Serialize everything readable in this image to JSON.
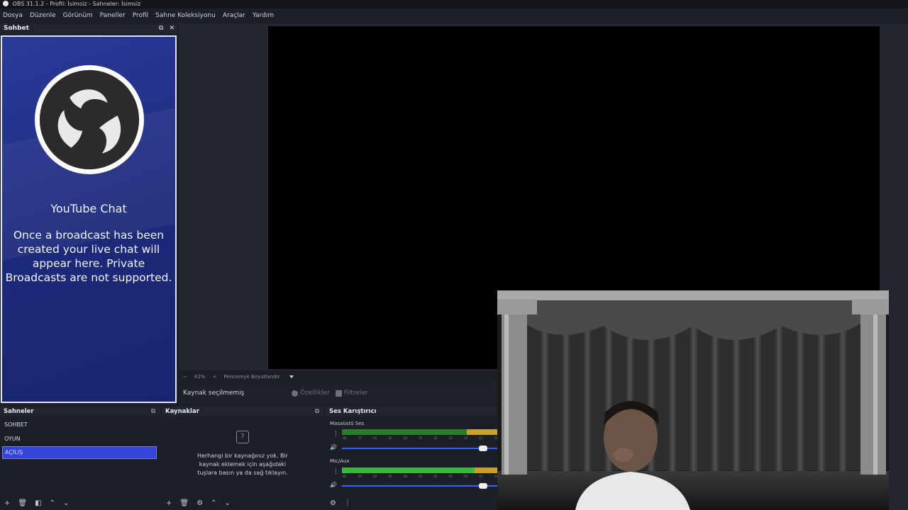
{
  "window": {
    "title": "OBS 31.1.2 - Profil: İsimsiz - Sahneler: İsimsiz"
  },
  "menu": [
    "Dosya",
    "Düzenle",
    "Görünüm",
    "Paneller",
    "Profil",
    "Sahne Koleksiyonu",
    "Araçlar",
    "Yardım"
  ],
  "chat_dock": {
    "title": "Sohbet",
    "heading": "YouTube Chat",
    "message": "Once a broadcast has been created your live chat will appear here. Private Broadcasts are not supported."
  },
  "preview": {
    "zoom": "62%",
    "fit_label": "Pencereye Boyutlandır"
  },
  "source_toolbar": {
    "no_source": "Kaynak seçilmemiş",
    "properties": "Özellikler",
    "filters": "Filtreler"
  },
  "scenes": {
    "title": "Sahneler",
    "items": [
      "SOHBET",
      "OYUN",
      "AÇILIŞ"
    ],
    "selected": "AÇILIŞ"
  },
  "sources": {
    "title": "Kaynaklar",
    "empty_message": "Herhangi bir kaynağınız yok. Bir kaynak eklemek için aşağıdaki tuşlara basın ya da sağ tıklayın."
  },
  "mixer": {
    "title": "Ses Karıştırıcı",
    "channels": [
      {
        "name": "Masaüstü Ses",
        "level": 0.8,
        "volume": 0.93
      },
      {
        "name": "Mic/Aux",
        "level": 0.85,
        "volume": 1.0
      }
    ],
    "tick_labels": [
      "-60",
      "-55",
      "-50",
      "-45",
      "-40",
      "-35",
      "-30",
      "-25",
      "-20",
      "-15",
      "-10"
    ]
  },
  "colors": {
    "accent": "#3344d6",
    "chat_bg": "#1c2a7a",
    "meter_green": "#3ab83a",
    "meter_yellow": "#c9a02a"
  }
}
